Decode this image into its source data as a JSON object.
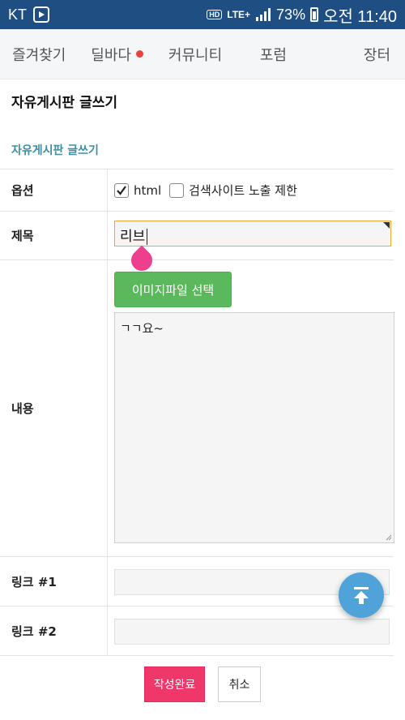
{
  "status_bar": {
    "carrier": "KT",
    "hd": "HD",
    "network": "LTE+",
    "battery": "73%",
    "time": "오전 11:40"
  },
  "nav": {
    "tabs": [
      {
        "label": "즐겨찾기"
      },
      {
        "label": "딜바다",
        "has_dot": true
      },
      {
        "label": "커뮤니티"
      },
      {
        "label": "포럼"
      },
      {
        "label": "장터"
      }
    ]
  },
  "page": {
    "title": "자유게시판 글쓰기",
    "section_title": "자유게시판 글쓰기"
  },
  "form": {
    "option_label": "옵션",
    "options": [
      {
        "label": "html",
        "checked": true
      },
      {
        "label": "검색사이트 노출 제한",
        "checked": false
      }
    ],
    "subject_label": "제목",
    "subject_value": "리브",
    "content_label": "내용",
    "image_button": "이미지파일 선택",
    "content_value": "ㄱㄱ요~",
    "link1_label": "링크 #1",
    "link1_value": "",
    "link2_label": "링크 #2",
    "link2_value": ""
  },
  "actions": {
    "submit": "작성완료",
    "cancel": "취소"
  },
  "colors": {
    "status_bar": "#1f4f82",
    "accent": "#3d8ea3",
    "submit": "#f0376a",
    "image_button": "#5cb85c",
    "fab": "#4fa3d9"
  }
}
